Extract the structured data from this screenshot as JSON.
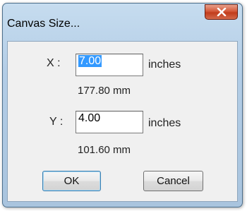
{
  "window": {
    "title": "Canvas Size..."
  },
  "icons": {
    "close": "close-icon"
  },
  "x": {
    "label": "X :",
    "value": "7.00",
    "unit": "inches",
    "metric": "177.80 mm"
  },
  "y": {
    "label": "Y :",
    "value": "4.00",
    "unit": "inches",
    "metric": "101.60 mm"
  },
  "buttons": {
    "ok": "OK",
    "cancel": "Cancel"
  }
}
